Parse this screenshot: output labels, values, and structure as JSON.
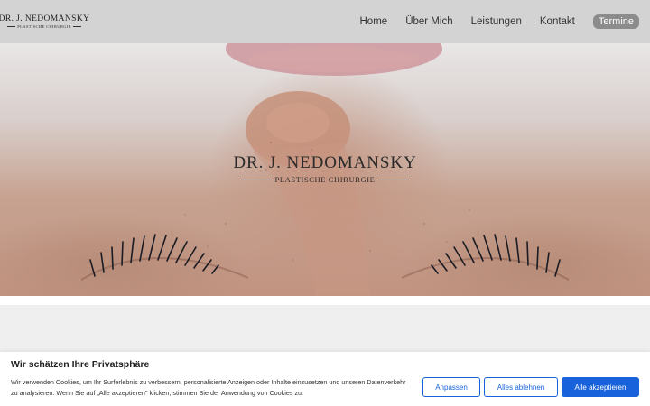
{
  "header": {
    "logo_title": "DR. J. NEDOMANSKY",
    "logo_subtitle": "PLASTISCHE CHIRURGIE",
    "nav": [
      "Home",
      "Über Mich",
      "Leistungen",
      "Kontakt"
    ],
    "cta_label": "Termine"
  },
  "hero": {
    "title": "DR. J. NEDOMANSKY",
    "subtitle": "PLASTISCHE CHIRURGIE"
  },
  "cookie_banner": {
    "title": "Wir schätzen Ihre Privatsphäre",
    "text": "Wir verwenden Cookies, um Ihr Surferlebnis zu verbessern, personalisierte Anzeigen oder Inhalte einzusetzen und unseren Datenverkehr zu analysieren. Wenn Sie auf „Alle akzeptieren\" klicken, stimmen Sie der Anwendung von Cookies zu.",
    "customize_label": "Anpassen",
    "reject_label": "Alles ablehnen",
    "accept_label": "Alle akzeptieren"
  },
  "colors": {
    "header_bg": "#d3d3d3",
    "accent_blue": "#1863dc",
    "cta_bg": "#8c8c8c"
  }
}
